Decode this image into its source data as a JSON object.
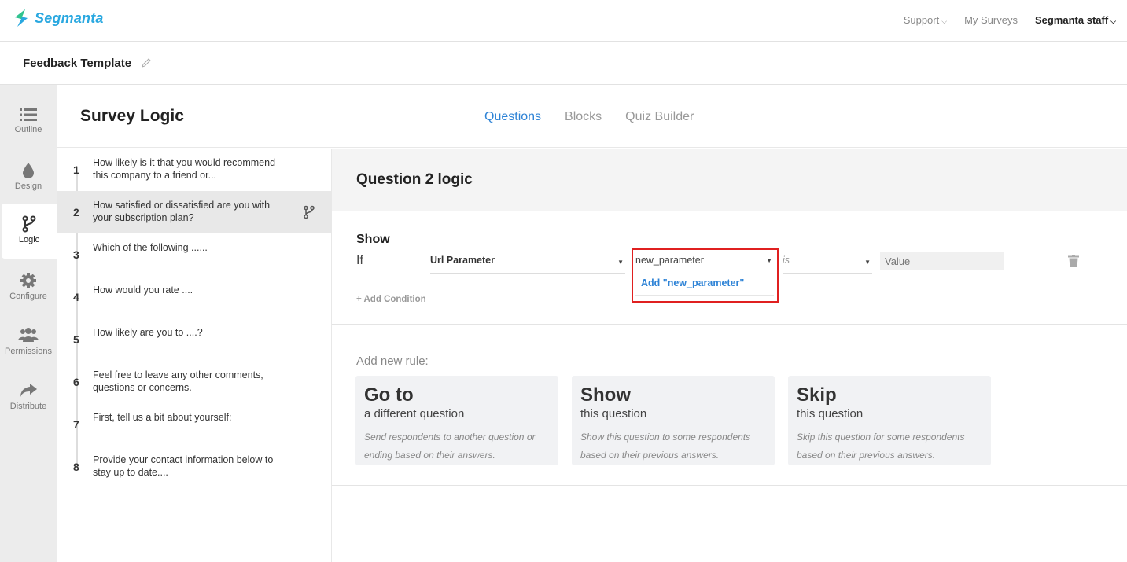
{
  "app": {
    "brand": "Segmanta",
    "brand_color": "#2aa8e0",
    "accent": "#2e83d6",
    "highlight": "#e02020"
  },
  "topnav": {
    "support": "Support",
    "my_surveys": "My Surveys",
    "user": "Segmanta staff"
  },
  "survey": {
    "title": "Feedback Template"
  },
  "sidebar": {
    "items": [
      {
        "label": "Outline",
        "icon": "list-icon"
      },
      {
        "label": "Design",
        "icon": "droplet-icon"
      },
      {
        "label": "Logic",
        "icon": "branch-icon",
        "active": true
      },
      {
        "label": "Configure",
        "icon": "gear-icon"
      },
      {
        "label": "Permissions",
        "icon": "users-icon"
      },
      {
        "label": "Distribute",
        "icon": "share-arrow-icon"
      }
    ]
  },
  "header": {
    "title": "Survey Logic",
    "tabs": [
      {
        "label": "Questions",
        "active": true
      },
      {
        "label": "Blocks"
      },
      {
        "label": "Quiz Builder"
      }
    ]
  },
  "questions": [
    {
      "num": "1",
      "text": "How likely is it that you would recommend this company to a friend or..."
    },
    {
      "num": "2",
      "text": "How satisfied or dissatisfied are you with your subscription plan?",
      "active": true
    },
    {
      "num": "3",
      "text": "Which of the following ......"
    },
    {
      "num": "4",
      "text": "How would you rate ...."
    },
    {
      "num": "5",
      "text": "How likely are you to ....?"
    },
    {
      "num": "6",
      "text": "Feel free to leave any other comments, questions or concerns."
    },
    {
      "num": "7",
      "text": "First, tell us a bit about yourself:"
    },
    {
      "num": "8",
      "text": "Provide your contact information below to stay up to date...."
    }
  ],
  "logic": {
    "title": "Question 2 logic",
    "rule": {
      "action": "Show",
      "if_label": "If",
      "source": "Url Parameter",
      "parameter": "new_parameter",
      "parameter_option": "Add \"new_parameter\"",
      "operator": "is",
      "value_placeholder": "Value",
      "add_condition": "+ Add Condition"
    },
    "new_rule_label": "Add new rule:",
    "cards": [
      {
        "title": "Go to",
        "subtitle": "a different question",
        "desc": "Send respondents to another question or ending based on their answers."
      },
      {
        "title": "Show",
        "subtitle": "this question",
        "desc": "Show this question to some respondents based on their previous answers."
      },
      {
        "title": "Skip",
        "subtitle": "this question",
        "desc": "Skip this question for some respondents based on their previous answers."
      }
    ]
  }
}
